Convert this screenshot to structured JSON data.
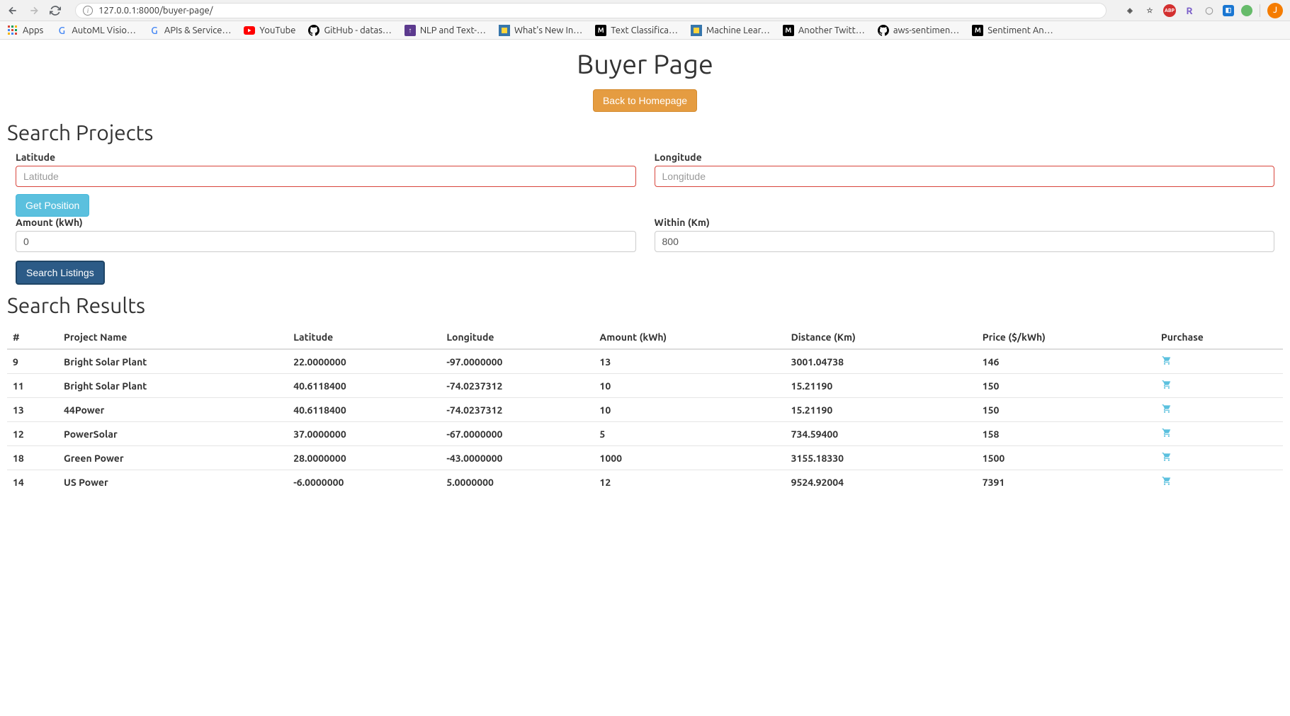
{
  "browser": {
    "url": "127.0.0.1:8000/buyer-page/",
    "avatar_letter": "J"
  },
  "bookmarks": [
    {
      "label": "Apps",
      "icon": "apps",
      "color": ""
    },
    {
      "label": "AutoML Visio…",
      "icon": "G",
      "color": "#4285f4"
    },
    {
      "label": "APIs & Service…",
      "icon": "G",
      "color": "#4285f4"
    },
    {
      "label": "YouTube",
      "icon": "yt",
      "color": "#ff0000"
    },
    {
      "label": "GitHub - datas…",
      "icon": "gh",
      "color": "#000"
    },
    {
      "label": "NLP and Text-…",
      "icon": "↑",
      "color": "#5c3a8e"
    },
    {
      "label": "What's New In…",
      "icon": "py",
      "color": "#3776ab"
    },
    {
      "label": "Text Classifica…",
      "icon": "M",
      "color": "#000"
    },
    {
      "label": "Machine Lear…",
      "icon": "py",
      "color": "#3776ab"
    },
    {
      "label": "Another Twitt…",
      "icon": "M",
      "color": "#000"
    },
    {
      "label": "aws-sentimen…",
      "icon": "gh",
      "color": "#000"
    },
    {
      "label": "Sentiment An…",
      "icon": "M",
      "color": "#000"
    }
  ],
  "page": {
    "title": "Buyer Page",
    "back_btn": "Back to Homepage",
    "search_heading": "Search Projects",
    "results_heading": "Search Results"
  },
  "form": {
    "lat_label": "Latitude",
    "lat_placeholder": "Latitude",
    "lon_label": "Longitude",
    "lon_placeholder": "Longitude",
    "get_position": "Get Position",
    "amount_label": "Amount (kWh)",
    "amount_value": "0",
    "within_label": "Within (Km)",
    "within_value": "800",
    "search_btn": "Search Listings"
  },
  "table": {
    "headers": [
      "#",
      "Project Name",
      "Latitude",
      "Longitude",
      "Amount (kWh)",
      "Distance (Km)",
      "Price ($/kWh)",
      "Purchase"
    ],
    "rows": [
      {
        "id": "9",
        "name": "Bright Solar Plant",
        "lat": "22.0000000",
        "lon": "-97.0000000",
        "amount": "13",
        "dist": "3001.04738",
        "price": "146"
      },
      {
        "id": "11",
        "name": "Bright Solar Plant",
        "lat": "40.6118400",
        "lon": "-74.0237312",
        "amount": "10",
        "dist": "15.21190",
        "price": "150"
      },
      {
        "id": "13",
        "name": "44Power",
        "lat": "40.6118400",
        "lon": "-74.0237312",
        "amount": "10",
        "dist": "15.21190",
        "price": "150"
      },
      {
        "id": "12",
        "name": "PowerSolar",
        "lat": "37.0000000",
        "lon": "-67.0000000",
        "amount": "5",
        "dist": "734.59400",
        "price": "158"
      },
      {
        "id": "18",
        "name": "Green Power",
        "lat": "28.0000000",
        "lon": "-43.0000000",
        "amount": "1000",
        "dist": "3155.18330",
        "price": "1500"
      },
      {
        "id": "14",
        "name": "US Power",
        "lat": "-6.0000000",
        "lon": "5.0000000",
        "amount": "12",
        "dist": "9524.92004",
        "price": "7391"
      }
    ]
  }
}
